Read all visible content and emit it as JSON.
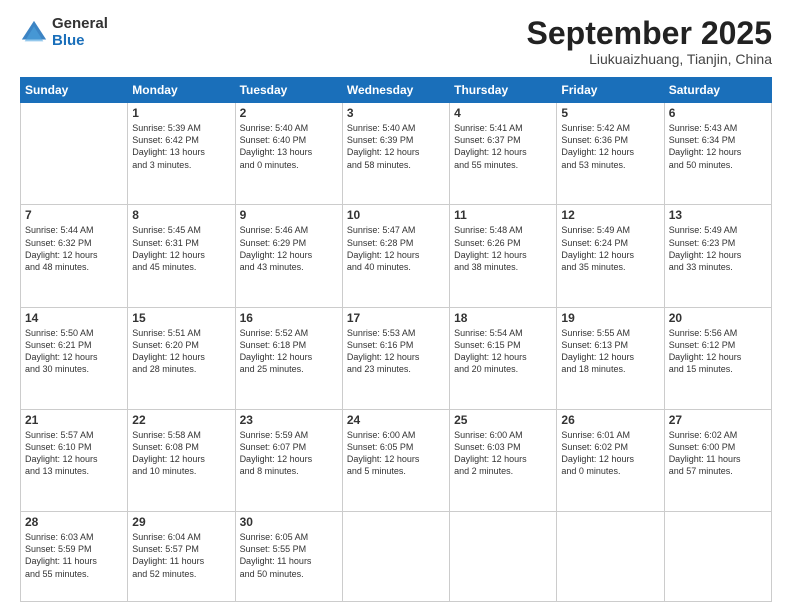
{
  "logo": {
    "general": "General",
    "blue": "Blue"
  },
  "header": {
    "month": "September 2025",
    "location": "Liukuaizhuang, Tianjin, China"
  },
  "weekdays": [
    "Sunday",
    "Monday",
    "Tuesday",
    "Wednesday",
    "Thursday",
    "Friday",
    "Saturday"
  ],
  "weeks": [
    [
      {
        "day": "",
        "info": ""
      },
      {
        "day": "1",
        "info": "Sunrise: 5:39 AM\nSunset: 6:42 PM\nDaylight: 13 hours\nand 3 minutes."
      },
      {
        "day": "2",
        "info": "Sunrise: 5:40 AM\nSunset: 6:40 PM\nDaylight: 13 hours\nand 0 minutes."
      },
      {
        "day": "3",
        "info": "Sunrise: 5:40 AM\nSunset: 6:39 PM\nDaylight: 12 hours\nand 58 minutes."
      },
      {
        "day": "4",
        "info": "Sunrise: 5:41 AM\nSunset: 6:37 PM\nDaylight: 12 hours\nand 55 minutes."
      },
      {
        "day": "5",
        "info": "Sunrise: 5:42 AM\nSunset: 6:36 PM\nDaylight: 12 hours\nand 53 minutes."
      },
      {
        "day": "6",
        "info": "Sunrise: 5:43 AM\nSunset: 6:34 PM\nDaylight: 12 hours\nand 50 minutes."
      }
    ],
    [
      {
        "day": "7",
        "info": "Sunrise: 5:44 AM\nSunset: 6:32 PM\nDaylight: 12 hours\nand 48 minutes."
      },
      {
        "day": "8",
        "info": "Sunrise: 5:45 AM\nSunset: 6:31 PM\nDaylight: 12 hours\nand 45 minutes."
      },
      {
        "day": "9",
        "info": "Sunrise: 5:46 AM\nSunset: 6:29 PM\nDaylight: 12 hours\nand 43 minutes."
      },
      {
        "day": "10",
        "info": "Sunrise: 5:47 AM\nSunset: 6:28 PM\nDaylight: 12 hours\nand 40 minutes."
      },
      {
        "day": "11",
        "info": "Sunrise: 5:48 AM\nSunset: 6:26 PM\nDaylight: 12 hours\nand 38 minutes."
      },
      {
        "day": "12",
        "info": "Sunrise: 5:49 AM\nSunset: 6:24 PM\nDaylight: 12 hours\nand 35 minutes."
      },
      {
        "day": "13",
        "info": "Sunrise: 5:49 AM\nSunset: 6:23 PM\nDaylight: 12 hours\nand 33 minutes."
      }
    ],
    [
      {
        "day": "14",
        "info": "Sunrise: 5:50 AM\nSunset: 6:21 PM\nDaylight: 12 hours\nand 30 minutes."
      },
      {
        "day": "15",
        "info": "Sunrise: 5:51 AM\nSunset: 6:20 PM\nDaylight: 12 hours\nand 28 minutes."
      },
      {
        "day": "16",
        "info": "Sunrise: 5:52 AM\nSunset: 6:18 PM\nDaylight: 12 hours\nand 25 minutes."
      },
      {
        "day": "17",
        "info": "Sunrise: 5:53 AM\nSunset: 6:16 PM\nDaylight: 12 hours\nand 23 minutes."
      },
      {
        "day": "18",
        "info": "Sunrise: 5:54 AM\nSunset: 6:15 PM\nDaylight: 12 hours\nand 20 minutes."
      },
      {
        "day": "19",
        "info": "Sunrise: 5:55 AM\nSunset: 6:13 PM\nDaylight: 12 hours\nand 18 minutes."
      },
      {
        "day": "20",
        "info": "Sunrise: 5:56 AM\nSunset: 6:12 PM\nDaylight: 12 hours\nand 15 minutes."
      }
    ],
    [
      {
        "day": "21",
        "info": "Sunrise: 5:57 AM\nSunset: 6:10 PM\nDaylight: 12 hours\nand 13 minutes."
      },
      {
        "day": "22",
        "info": "Sunrise: 5:58 AM\nSunset: 6:08 PM\nDaylight: 12 hours\nand 10 minutes."
      },
      {
        "day": "23",
        "info": "Sunrise: 5:59 AM\nSunset: 6:07 PM\nDaylight: 12 hours\nand 8 minutes."
      },
      {
        "day": "24",
        "info": "Sunrise: 6:00 AM\nSunset: 6:05 PM\nDaylight: 12 hours\nand 5 minutes."
      },
      {
        "day": "25",
        "info": "Sunrise: 6:00 AM\nSunset: 6:03 PM\nDaylight: 12 hours\nand 2 minutes."
      },
      {
        "day": "26",
        "info": "Sunrise: 6:01 AM\nSunset: 6:02 PM\nDaylight: 12 hours\nand 0 minutes."
      },
      {
        "day": "27",
        "info": "Sunrise: 6:02 AM\nSunset: 6:00 PM\nDaylight: 11 hours\nand 57 minutes."
      }
    ],
    [
      {
        "day": "28",
        "info": "Sunrise: 6:03 AM\nSunset: 5:59 PM\nDaylight: 11 hours\nand 55 minutes."
      },
      {
        "day": "29",
        "info": "Sunrise: 6:04 AM\nSunset: 5:57 PM\nDaylight: 11 hours\nand 52 minutes."
      },
      {
        "day": "30",
        "info": "Sunrise: 6:05 AM\nSunset: 5:55 PM\nDaylight: 11 hours\nand 50 minutes."
      },
      {
        "day": "",
        "info": ""
      },
      {
        "day": "",
        "info": ""
      },
      {
        "day": "",
        "info": ""
      },
      {
        "day": "",
        "info": ""
      }
    ]
  ]
}
